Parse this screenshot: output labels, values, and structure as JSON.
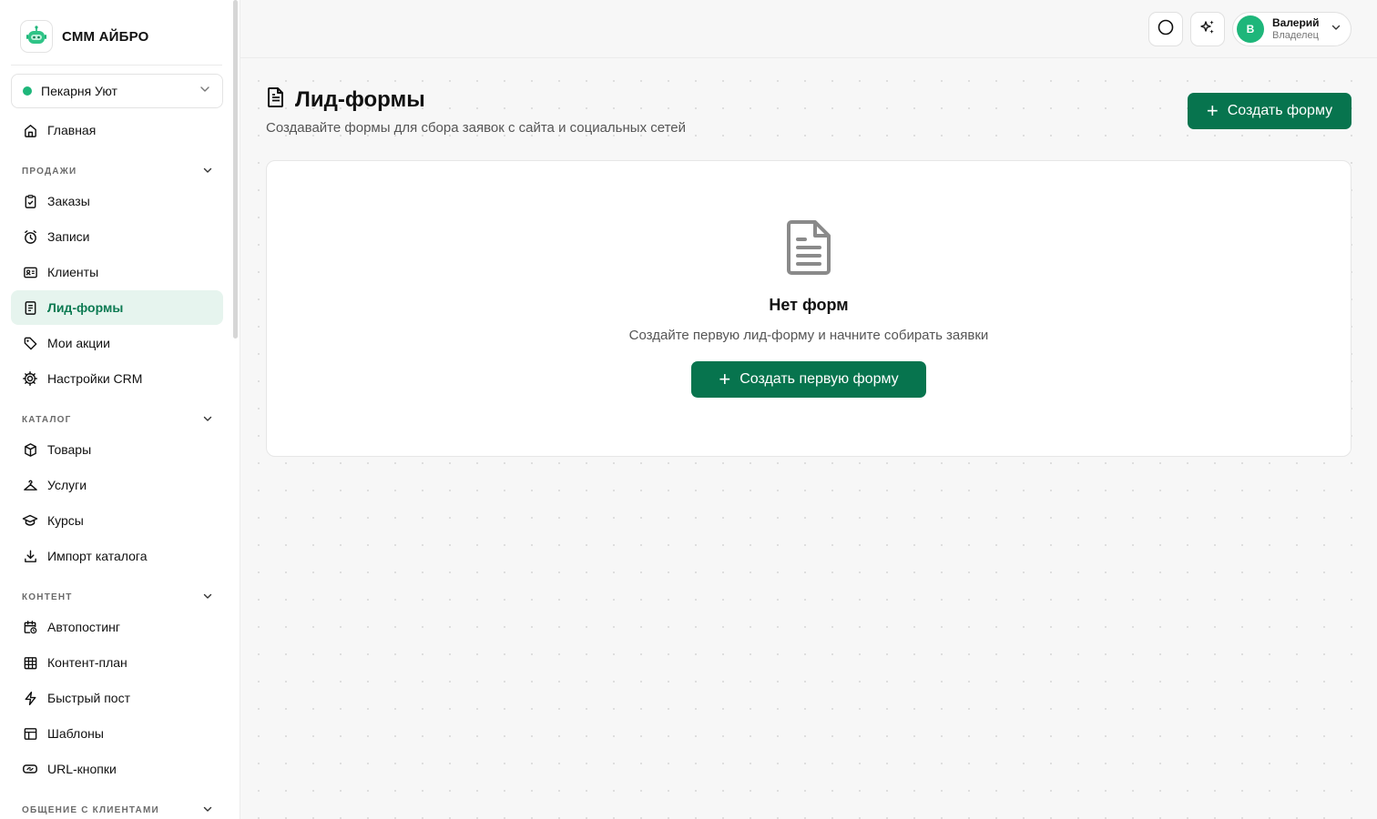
{
  "brand": {
    "name": "СММ АЙБРО"
  },
  "store": {
    "name": "Пекарня Уют",
    "status_color": "#1eb67a"
  },
  "nav": {
    "home": "Главная",
    "sections": {
      "sales": "ПРОДАЖИ",
      "catalog": "КАТАЛОГ",
      "content": "КОНТЕНТ",
      "communication": "ОБЩЕНИЕ С КЛИЕНТАМИ"
    },
    "sales_items": [
      {
        "label": "Заказы",
        "icon": "clipboard-check-icon"
      },
      {
        "label": "Записи",
        "icon": "alarm-clock-icon"
      },
      {
        "label": "Клиенты",
        "icon": "contact-card-icon"
      },
      {
        "label": "Лид-формы",
        "icon": "form-icon",
        "active": true
      },
      {
        "label": "Мои акции",
        "icon": "tag-icon"
      },
      {
        "label": "Настройки CRM",
        "icon": "gear-icon"
      }
    ],
    "catalog_items": [
      {
        "label": "Товары",
        "icon": "box-icon"
      },
      {
        "label": "Услуги",
        "icon": "hanger-icon"
      },
      {
        "label": "Курсы",
        "icon": "graduation-cap-icon"
      },
      {
        "label": "Импорт каталога",
        "icon": "download-icon"
      }
    ],
    "content_items": [
      {
        "label": "Автопостинг",
        "icon": "calendar-clock-icon"
      },
      {
        "label": "Контент-план",
        "icon": "grid-calendar-icon"
      },
      {
        "label": "Быстрый пост",
        "icon": "lightning-icon"
      },
      {
        "label": "Шаблоны",
        "icon": "layout-icon"
      },
      {
        "label": "URL-кнопки",
        "icon": "link-button-icon"
      }
    ]
  },
  "topbar": {
    "user": {
      "initial": "В",
      "name": "Валерий",
      "role": "Владелец"
    }
  },
  "page": {
    "title": "Лид-формы",
    "subtitle": "Создавайте формы для сбора заявок с сайта и социальных сетей",
    "create_button": "Создать форму",
    "empty": {
      "title": "Нет форм",
      "text": "Создайте первую лид-форму и начните собирать заявки",
      "button": "Создать первую форму"
    }
  },
  "colors": {
    "accent": "#07744e",
    "active_bg": "#e6f4ee",
    "active_text": "#0c7a52",
    "avatar": "#1eb67a"
  }
}
